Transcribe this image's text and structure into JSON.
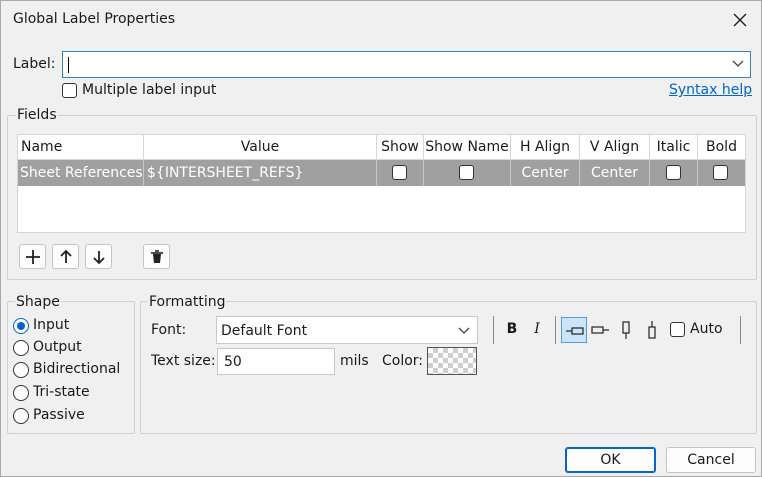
{
  "window": {
    "title": "Global Label Properties"
  },
  "label_field": {
    "caption": "Label:",
    "value": "",
    "multiple_label": "Multiple label input",
    "syntax_help": "Syntax help"
  },
  "fields": {
    "title": "Fields",
    "columns": [
      "Name",
      "Value",
      "Show",
      "Show Name",
      "H Align",
      "V Align",
      "Italic",
      "Bold"
    ],
    "rows": [
      {
        "name": "Sheet References",
        "value": "${INTERSHEET_REFS}",
        "show": false,
        "show_name": false,
        "h_align": "Center",
        "v_align": "Center",
        "italic": false,
        "bold": false
      }
    ]
  },
  "shape": {
    "title": "Shape",
    "options": [
      "Input",
      "Output",
      "Bidirectional",
      "Tri-state",
      "Passive"
    ],
    "selected": "Input"
  },
  "formatting": {
    "title": "Formatting",
    "font_label": "Font:",
    "font_value": "Default Font",
    "bold_glyph": "B",
    "italic_glyph": "I",
    "auto_label": "Auto",
    "text_size_label": "Text size:",
    "text_size_value": "50",
    "units": "mils",
    "color_label": "Color:"
  },
  "buttons": {
    "ok": "OK",
    "cancel": "Cancel"
  }
}
